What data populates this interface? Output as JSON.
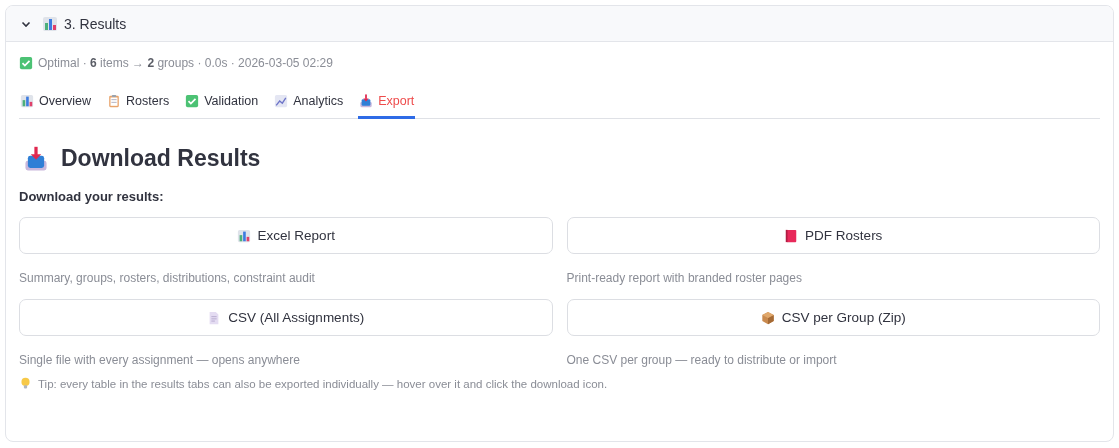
{
  "section": {
    "title": "3. Results",
    "expanded": true,
    "kind": "chart"
  },
  "status": {
    "kind": "check",
    "text": "Optimal · **6** items → **2** groups · 0.0s · 2026-03-05 02:29"
  },
  "tabs": [
    {
      "label": "Overview",
      "kind": "chart",
      "selected": false
    },
    {
      "label": "Rosters",
      "kind": "clipboard",
      "selected": false
    },
    {
      "label": "Validation",
      "kind": "check",
      "selected": false
    },
    {
      "label": "Analytics",
      "kind": "trend",
      "selected": false
    },
    {
      "label": "Export",
      "kind": "tray",
      "selected": true
    }
  ],
  "heading": {
    "text": "Download Results",
    "kind": "tray"
  },
  "subheading": "Download your results:",
  "downloads": [
    {
      "label": "Excel Report",
      "kind": "chart",
      "caption": "Summary, groups, rosters, distributions, constraint audit"
    },
    {
      "label": "PDF Rosters",
      "kind": "book",
      "caption": "Print-ready report with branded roster pages"
    },
    {
      "label": "CSV (All Assignments)",
      "kind": "page",
      "caption": "Single file with every assignment — opens anywhere"
    },
    {
      "label": "CSV per Group (Zip)",
      "kind": "package",
      "caption": "One CSV per group — ready to distribute or import"
    }
  ],
  "tip": {
    "kind": "bulb",
    "text": "Tip: every table in the results tabs can also be exported individually — hover over it and click the download icon."
  }
}
